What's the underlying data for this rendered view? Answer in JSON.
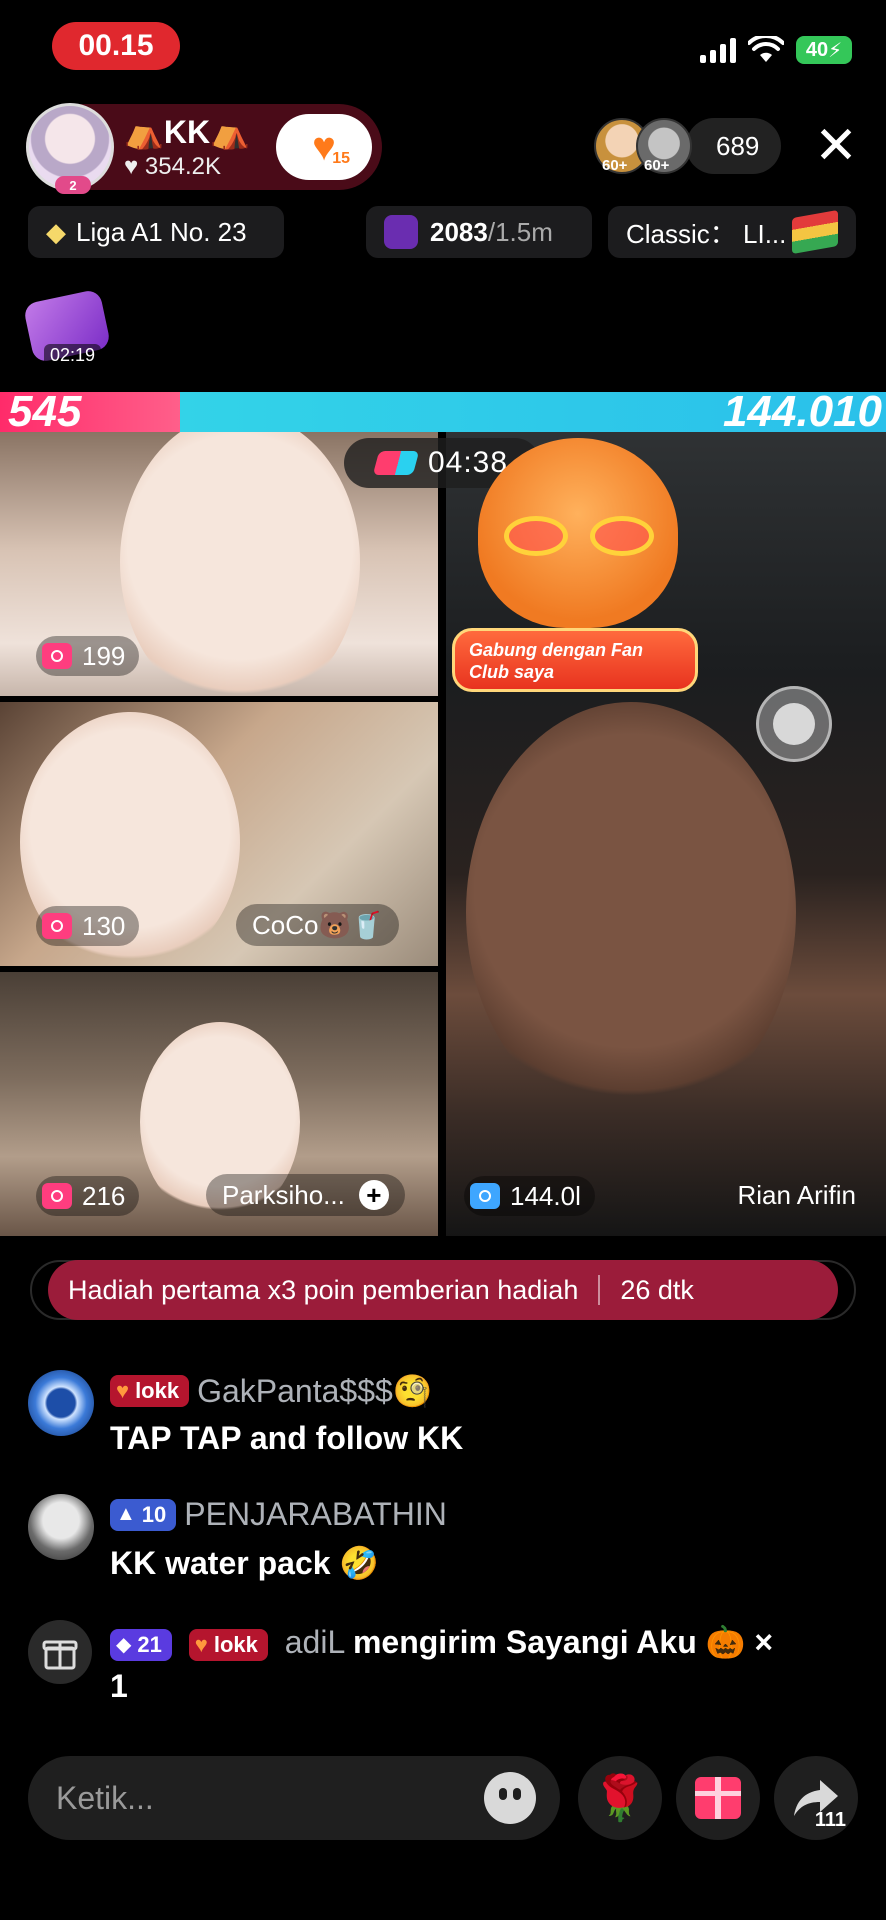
{
  "status_bar": {
    "time": "00.15",
    "battery": "40"
  },
  "host": {
    "name": "⛺KK⛺",
    "likes": "♥ 354.2K",
    "level_badge": "2",
    "fan_count": "15"
  },
  "viewers": {
    "badge_1": "60+",
    "badge_2": "60+",
    "count": "689"
  },
  "chips": {
    "league": "Liga A1 No. 23",
    "score_main": "2083",
    "score_total": "/1.5m",
    "classic": "Classic： LI..."
  },
  "gift_timer": "02:19",
  "battle": {
    "left_score": "545",
    "right_score": "144.010",
    "timer": "04:38"
  },
  "tiles": [
    {
      "gifts": "199",
      "name": ""
    },
    {
      "gifts": "130",
      "name": "CoCo🐻🥤"
    },
    {
      "gifts": "216",
      "name": "Parksiho..."
    },
    {
      "gifts": "144.0l",
      "name": "Rian Arifin"
    }
  ],
  "fan_club_banner": "Gabung dengan Fan Club saya",
  "announcement": {
    "text": "Hadiah pertama x3 poin pemberian hadiah",
    "countdown": "26 dtk"
  },
  "chat": [
    {
      "badges": [
        "lokk"
      ],
      "user": "GakPanta$$$🧐",
      "message": "TAP TAP and  follow KK"
    },
    {
      "level": "10",
      "user": "PENJARABATHIN",
      "message": "KK water pack 🤣"
    }
  ],
  "gift_event": {
    "level": "21",
    "club": "lokk",
    "user": "adiL",
    "text": "mengirim Sayangi Aku 🎃",
    "multiplier": "×",
    "count": "1"
  },
  "bottom_bar": {
    "placeholder": "Ketik...",
    "rose": "🌹",
    "share_count": "111"
  },
  "colors": {
    "accent_red": "#e0282e",
    "battle_pink": "#ff2b6a",
    "battle_cyan": "#2ac0ea",
    "announce_bg": "#9b1c3a"
  }
}
